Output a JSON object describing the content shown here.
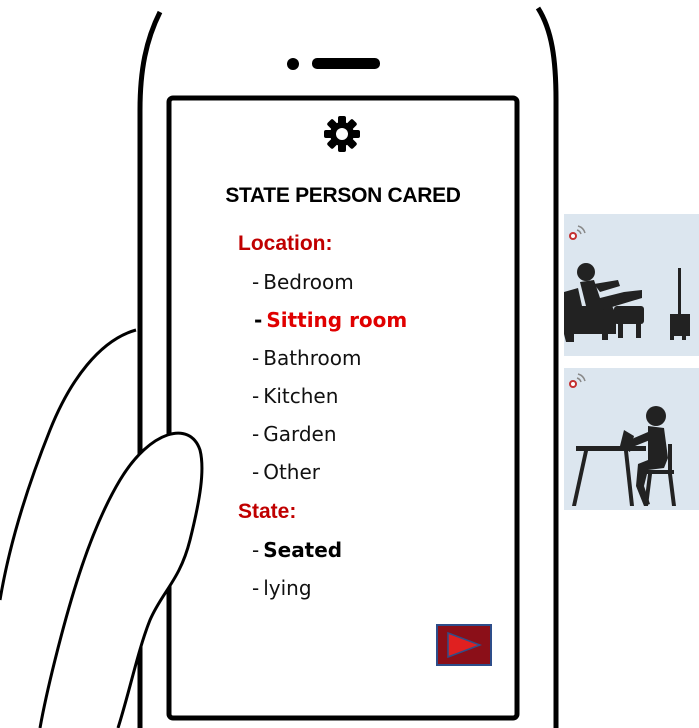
{
  "screen": {
    "settings_icon": "gear-icon",
    "title": "STATE PERSON CARED",
    "location": {
      "heading": "Location:",
      "items": [
        {
          "dash": "-",
          "label": "Bedroom"
        },
        {
          "dash": "-",
          "label": "Sitting room"
        },
        {
          "dash": "-",
          "label": "Bathroom"
        },
        {
          "dash": "-",
          "label": "Kitchen"
        },
        {
          "dash": "-",
          "label": "Garden"
        },
        {
          "dash": "-",
          "label": "Other"
        }
      ],
      "selected": "Sitting room"
    },
    "state": {
      "heading": "State:",
      "items": [
        {
          "dash": "-",
          "label": "Seated"
        },
        {
          "dash": "-",
          "label": "lying"
        }
      ],
      "selected": "Seated"
    },
    "next_icon": "play-triangle-icon"
  },
  "scenes": [
    {
      "icon": "sensor-icon",
      "depicts": "person-reclining-in-armchair-icon"
    },
    {
      "icon": "sensor-icon",
      "depicts": "person-reading-at-table-icon"
    }
  ],
  "colors": {
    "heading_red": "#c00000",
    "selected_red": "#e00000",
    "button_fill": "#8b0f18",
    "button_border": "#2e4e8a",
    "button_triangle": "#e02020",
    "card_bg": "#dce6ef",
    "silhouette": "#222222"
  }
}
